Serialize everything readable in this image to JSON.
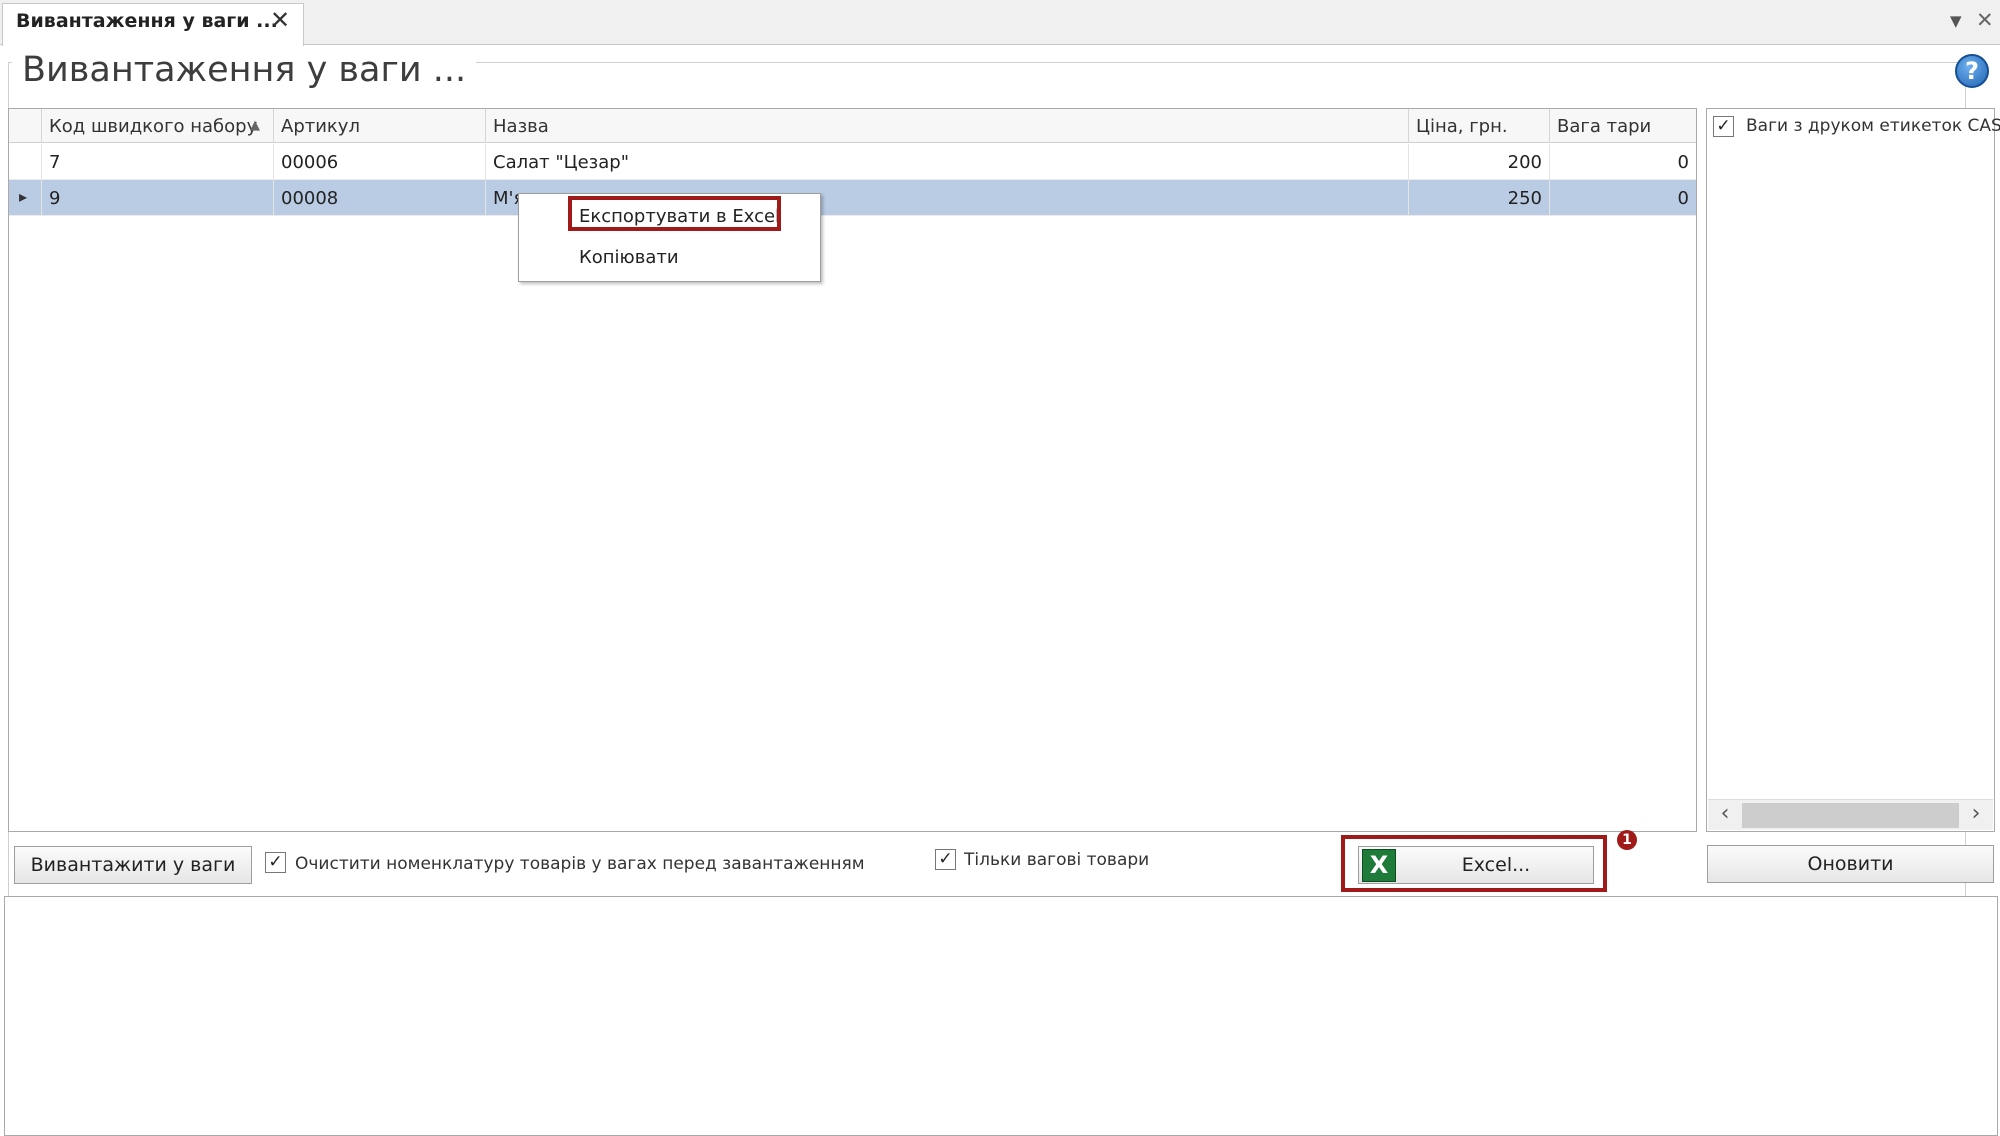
{
  "tab": {
    "label": "Вивантаження у ваги ...",
    "close": "✕"
  },
  "window_controls": {
    "dropdown": "▼",
    "close": "✕"
  },
  "page": {
    "title": "Вивантаження у ваги ...",
    "help": "?"
  },
  "grid": {
    "columns": [
      "Код швидкого набору",
      "Артикул",
      "Назва",
      "Ціна, грн.",
      "Вага тари"
    ],
    "sort_indicator": "▲",
    "rows": [
      {
        "code": "7",
        "article": "00006",
        "name": "Салат \"Цезар\"",
        "price": "200",
        "tare": "0",
        "selected": false
      },
      {
        "code": "9",
        "article": "00008",
        "name": "М'я",
        "price": "250",
        "tare": "0",
        "selected": true
      }
    ],
    "row_marker": "▸"
  },
  "context_menu": {
    "items": [
      "Експортувати в Excel",
      "Копіювати"
    ]
  },
  "right_panel": {
    "item_label": "Ваги з друком етикеток CAS",
    "checked": true,
    "scroll_left": "‹",
    "scroll_right": "›"
  },
  "toolbar": {
    "export_button": "Вивантажити у ваги",
    "clear_checkbox_label": "Очистити номенклатуру товарів у вагах перед завантаженням",
    "clear_checked": true,
    "weight_only_label": "Тільки вагові товари",
    "weight_only_checked": true,
    "excel_button": "Excel...",
    "excel_icon": "X",
    "badge": "1",
    "refresh_button": "Оновити",
    "check_mark": "✓"
  },
  "colors": {
    "accent_highlight": "#a11a1a",
    "selected_row": "#b9cce4",
    "excel_green": "#1e7b3a"
  }
}
